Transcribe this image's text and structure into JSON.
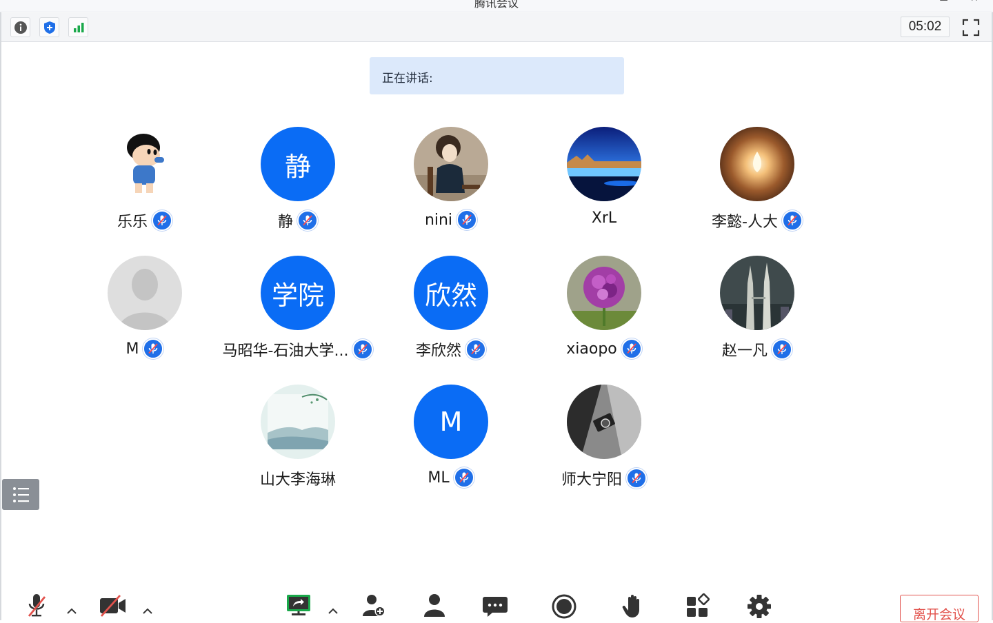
{
  "window": {
    "title": "腾讯会议",
    "min_glyph": "▬",
    "close_glyph": "✕"
  },
  "toolbar": {
    "icons": [
      "info-icon",
      "shield-icon",
      "signal-bars-icon"
    ],
    "timer": "05:02",
    "fullscreen_icon": "fullscreen-icon"
  },
  "speaking": {
    "label": "正在讲话:"
  },
  "participants": [
    {
      "name": "乐乐",
      "avatar_type": "image",
      "avatar_desc": "cartoon-boy-avatar",
      "mic_muted": true
    },
    {
      "name": "静",
      "avatar_type": "text",
      "avatar_text": "静",
      "mic_muted": true
    },
    {
      "name": "nini",
      "avatar_type": "image",
      "avatar_desc": "woman-portrait-avatar",
      "mic_muted": true
    },
    {
      "name": "XrL",
      "avatar_type": "image",
      "avatar_desc": "ocean-landscape-avatar",
      "mic_muted": false
    },
    {
      "name": "李懿-人大",
      "avatar_type": "image",
      "avatar_desc": "candle-light-avatar",
      "mic_muted": true
    },
    {
      "name": "M",
      "avatar_type": "image",
      "avatar_desc": "default-person-avatar",
      "mic_muted": true
    },
    {
      "name": "马昭华-石油大学...",
      "avatar_type": "text",
      "avatar_text": "学院",
      "mic_muted": true
    },
    {
      "name": "李欣然",
      "avatar_type": "text",
      "avatar_text": "欣然",
      "mic_muted": true
    },
    {
      "name": "xiaopo",
      "avatar_type": "image",
      "avatar_desc": "purple-flower-avatar",
      "mic_muted": true
    },
    {
      "name": "赵一凡",
      "avatar_type": "image",
      "avatar_desc": "city-towers-avatar",
      "mic_muted": true
    },
    {
      "name": "山大李海琳",
      "avatar_type": "image",
      "avatar_desc": "misty-landscape-avatar",
      "mic_muted": false
    },
    {
      "name": "ML",
      "avatar_type": "text",
      "avatar_text": "M",
      "mic_muted": true
    },
    {
      "name": "师大宁阳",
      "avatar_type": "image",
      "avatar_desc": "camera-photo-avatar",
      "mic_muted": true
    }
  ],
  "bottombar": {
    "buttons": [
      "mic-muted-icon",
      "camera-off-icon",
      "share-screen-icon",
      "invite-icon",
      "members-icon",
      "chat-icon",
      "record-icon",
      "raise-hand-icon",
      "apps-icon",
      "settings-icon"
    ],
    "leave_label": "离开会议"
  },
  "colors": {
    "accent": "#0a6cf5",
    "leave": "#e2524c",
    "speaking_bg": "#dce9fb"
  }
}
